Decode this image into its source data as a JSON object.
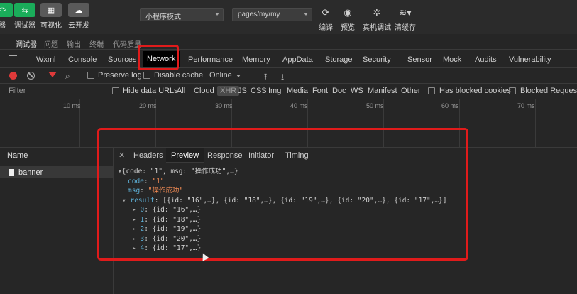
{
  "toolbar": {
    "buttons": [
      {
        "label": "器",
        "icon": "<>"
      },
      {
        "label": "调试器",
        "icon": "⇆"
      },
      {
        "label": "可视化",
        "icon": "▦"
      },
      {
        "label": "云开发",
        "icon": "☁"
      }
    ],
    "mode_select": "小程序模式",
    "page_select": "pages/my/my",
    "actions": [
      {
        "label": "编译",
        "icon": "refresh-icon"
      },
      {
        "label": "预览",
        "icon": "eye-icon"
      },
      {
        "label": "真机调试",
        "icon": "bug-icon"
      },
      {
        "label": "清缓存",
        "icon": "layers-icon"
      }
    ]
  },
  "subtabs": [
    "调试器",
    "问题",
    "输出",
    "终端",
    "代码质量"
  ],
  "devtools_tabs": [
    "Wxml",
    "Console",
    "Sources",
    "Network",
    "Performance",
    "Memory",
    "AppData",
    "Storage",
    "Security",
    "Sensor",
    "Mock",
    "Audits",
    "Vulnerability"
  ],
  "active_devtools_tab": "Network",
  "network_toolbar": {
    "preserve_log": "Preserve log",
    "disable_cache": "Disable cache",
    "throttle": "Online"
  },
  "filter": {
    "placeholder": "Filter",
    "hide_data_urls": "Hide data URLs",
    "types": [
      "All",
      "Cloud",
      "XHR",
      "JS",
      "CSS",
      "Img",
      "Media",
      "Font",
      "Doc",
      "WS",
      "Manifest",
      "Other"
    ],
    "active_type": "XHR",
    "has_blocked_cookies": "Has blocked cookies",
    "blocked_requests": "Blocked Requests"
  },
  "timeline_ticks": [
    "10 ms",
    "20 ms",
    "30 ms",
    "40 ms",
    "50 ms",
    "60 ms",
    "70 ms"
  ],
  "name_pane": {
    "header": "Name",
    "rows": [
      "banner"
    ]
  },
  "detail_tabs": [
    "Headers",
    "Preview",
    "Response",
    "Initiator",
    "Timing"
  ],
  "active_detail_tab": "Preview",
  "preview": {
    "summary": "{code: \"1\", msg: \"操作成功\",…}",
    "code_key": "code",
    "code_val": "\"1\"",
    "msg_key": "msg",
    "msg_val": "\"操作成功\"",
    "result_key": "result",
    "result_val": "[{id: \"16\",…}, {id: \"18\",…}, {id: \"19\",…}, {id: \"20\",…}, {id: \"17\",…}]",
    "items": [
      {
        "idx": "0",
        "val": "{id: \"16\",…}"
      },
      {
        "idx": "1",
        "val": "{id: \"18\",…}"
      },
      {
        "idx": "2",
        "val": "{id: \"19\",…}"
      },
      {
        "idx": "3",
        "val": "{id: \"20\",…}"
      },
      {
        "idx": "4",
        "val": "{id: \"17\",…}"
      }
    ]
  }
}
